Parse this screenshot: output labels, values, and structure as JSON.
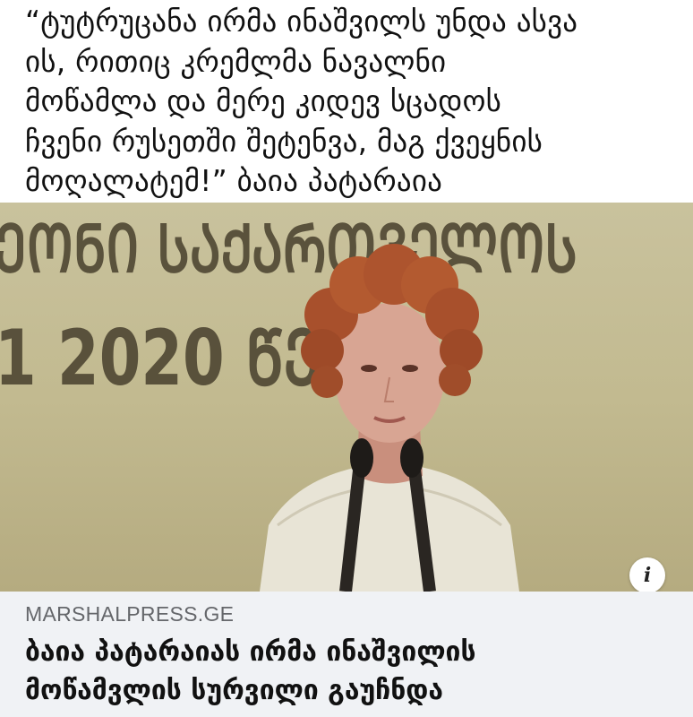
{
  "post": {
    "quote": "“ტუტრუცანა ირმა ინაშვილს უნდა ასვა\nის, რითიც კრემლმა ნავალნი\nმოწამლა და მერე კიდევ სცადოს\nჩვენი რუსეთში შეტენვა, მაგ ქვეყნის\nმოღალატემ!” ბაია პატარაია"
  },
  "photo": {
    "banner_top": "ᲔᲝᲜᲘ ᲡᲐᲥᲐᲠᲗᲕᲔᲚᲝᲡ",
    "banner_bottom": "1 2020 ᲬᲔ",
    "info_icon_glyph": "i"
  },
  "link_preview": {
    "domain": "MARSHALPRESS.GE",
    "title": "ბაია პატარაიას ირმა ინაშვილის\nმოწამვლის სურვილი გაუჩნდა"
  }
}
